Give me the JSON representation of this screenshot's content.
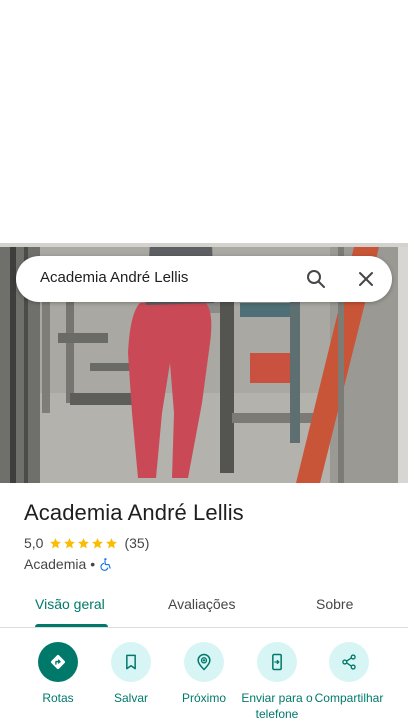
{
  "search": {
    "query": "Academia André Lellis"
  },
  "place": {
    "name": "Academia André Lellis",
    "rating": "5,0",
    "review_count": "(35)",
    "category": "Academia",
    "separator": "•",
    "star_color": "#fbbc04",
    "stars_filled": 5,
    "accessibility_icon": "wheelchair-icon"
  },
  "tabs": [
    {
      "label": "Visão geral",
      "active": true
    },
    {
      "label": "Avaliações",
      "active": false
    },
    {
      "label": "Sobre",
      "active": false
    }
  ],
  "actions": [
    {
      "label": "Rotas",
      "icon": "directions-icon"
    },
    {
      "label": "Salvar",
      "icon": "bookmark-icon"
    },
    {
      "label": "Próximo",
      "icon": "nearby-icon"
    },
    {
      "label": "Enviar para o telefone",
      "icon": "send-to-phone-icon"
    },
    {
      "label": "Compartilhar",
      "icon": "share-icon"
    }
  ],
  "colors": {
    "accent": "#00796b",
    "action_bg": "#d7f5f4",
    "text_secondary": "#444746"
  }
}
